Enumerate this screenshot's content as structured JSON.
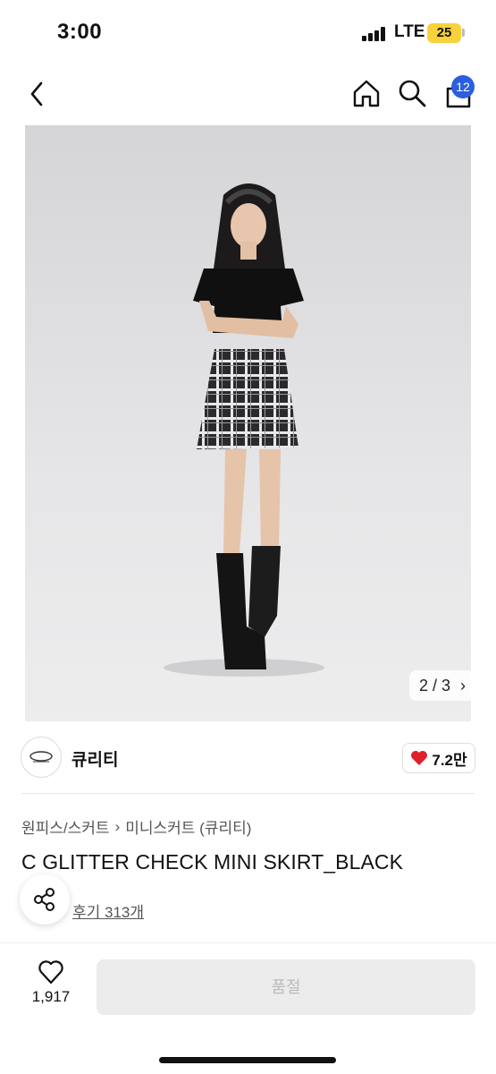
{
  "status_bar": {
    "time": "3:00",
    "network": "LTE",
    "battery": "25"
  },
  "nav": {
    "cart_count": "12",
    "icons": [
      "back-icon",
      "home-icon",
      "search-icon",
      "cart-icon"
    ]
  },
  "gallery": {
    "counter": "2 / 3"
  },
  "seller": {
    "name": "큐리티",
    "likes": "7.2만"
  },
  "product": {
    "breadcrumb": [
      "원피스/스커트",
      "미니스커트 (큐리티)"
    ],
    "title": "C GLITTER CHECK MINI SKIRT_BLACK",
    "review_link": "후기 313개"
  },
  "bottom_bar": {
    "wish_count": "1,917",
    "action_label": "품절"
  },
  "colors": {
    "accent_blue": "#2b5fe0",
    "heart_red": "#e0202a",
    "battery_yellow": "#f7d23b"
  }
}
